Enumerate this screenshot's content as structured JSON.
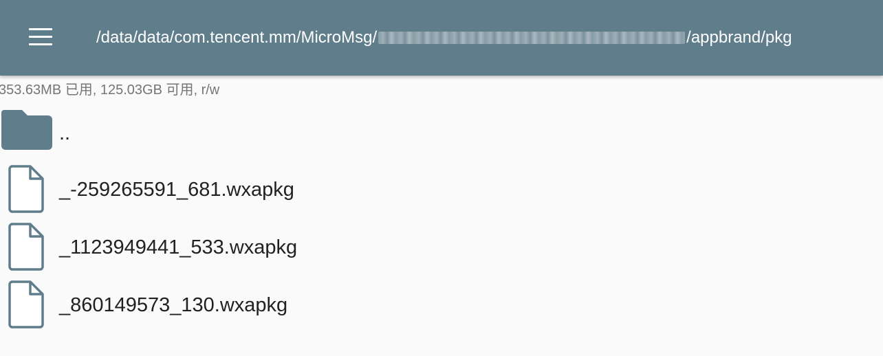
{
  "header": {
    "menu_icon": "hamburger-menu-icon",
    "path_prefix": "/data/data/com.tencent.mm/MicroMsg/",
    "path_suffix": "/appbrand/pkg",
    "color": "#607d8b"
  },
  "storage": {
    "info": "353.63MB 已用, 125.03GB 可用, r/w"
  },
  "files": [
    {
      "name": "..",
      "icon": "folder-icon",
      "type": "folder"
    },
    {
      "name": "_-259265591_681.wxapkg",
      "icon": "file-icon",
      "type": "file"
    },
    {
      "name": "_1123949441_533.wxapkg",
      "icon": "file-icon",
      "type": "file"
    },
    {
      "name": "_860149573_130.wxapkg",
      "icon": "file-icon",
      "type": "file"
    }
  ],
  "colors": {
    "accent": "#607d8b",
    "background": "#fafafa",
    "text": "#212121",
    "secondary_text": "#757575"
  }
}
